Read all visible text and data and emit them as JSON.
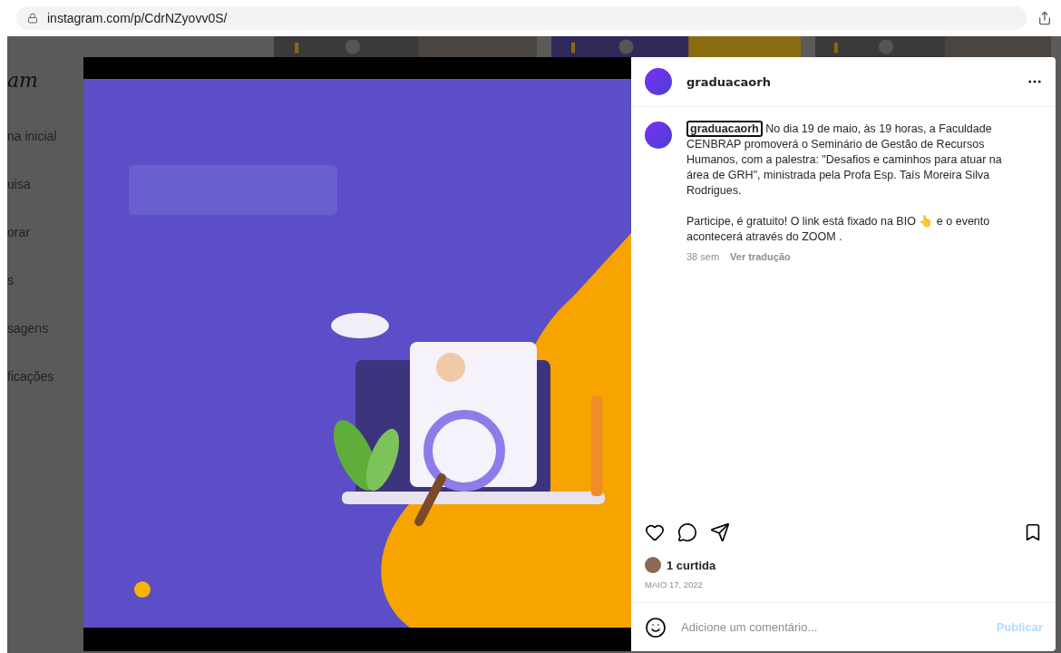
{
  "browser": {
    "url": "instagram.com/p/CdrNZyovv0S/"
  },
  "sidebar": {
    "logo": "am",
    "items": [
      "na inicial",
      "uisa",
      "orar",
      "s",
      "sagens",
      "ficações"
    ]
  },
  "post": {
    "author": "graduacaorh",
    "caption": {
      "username": "graduacaorh",
      "username_focused": true,
      "text": "No dia 19 de maio, às 19 horas, a Faculdade CENBRAP promoverá o Seminário de Gestão de Recursos Humanos, com a palestra: \"Desafios e caminhos para atuar na área de GRH\", ministrada pela Profa Esp. Taís Moreira Silva Rodrigues.",
      "text_2": "Participe, é gratuito! O link está fixado na BIO 👆 e o evento acontecerá através do ZOOM ."
    },
    "age": "38 sem",
    "translate": "Ver tradução",
    "likes": "1 curtida",
    "date": "MAIO 17, 2022",
    "comment": {
      "placeholder": "Adicione um comentário...",
      "submit": "Publicar"
    }
  }
}
